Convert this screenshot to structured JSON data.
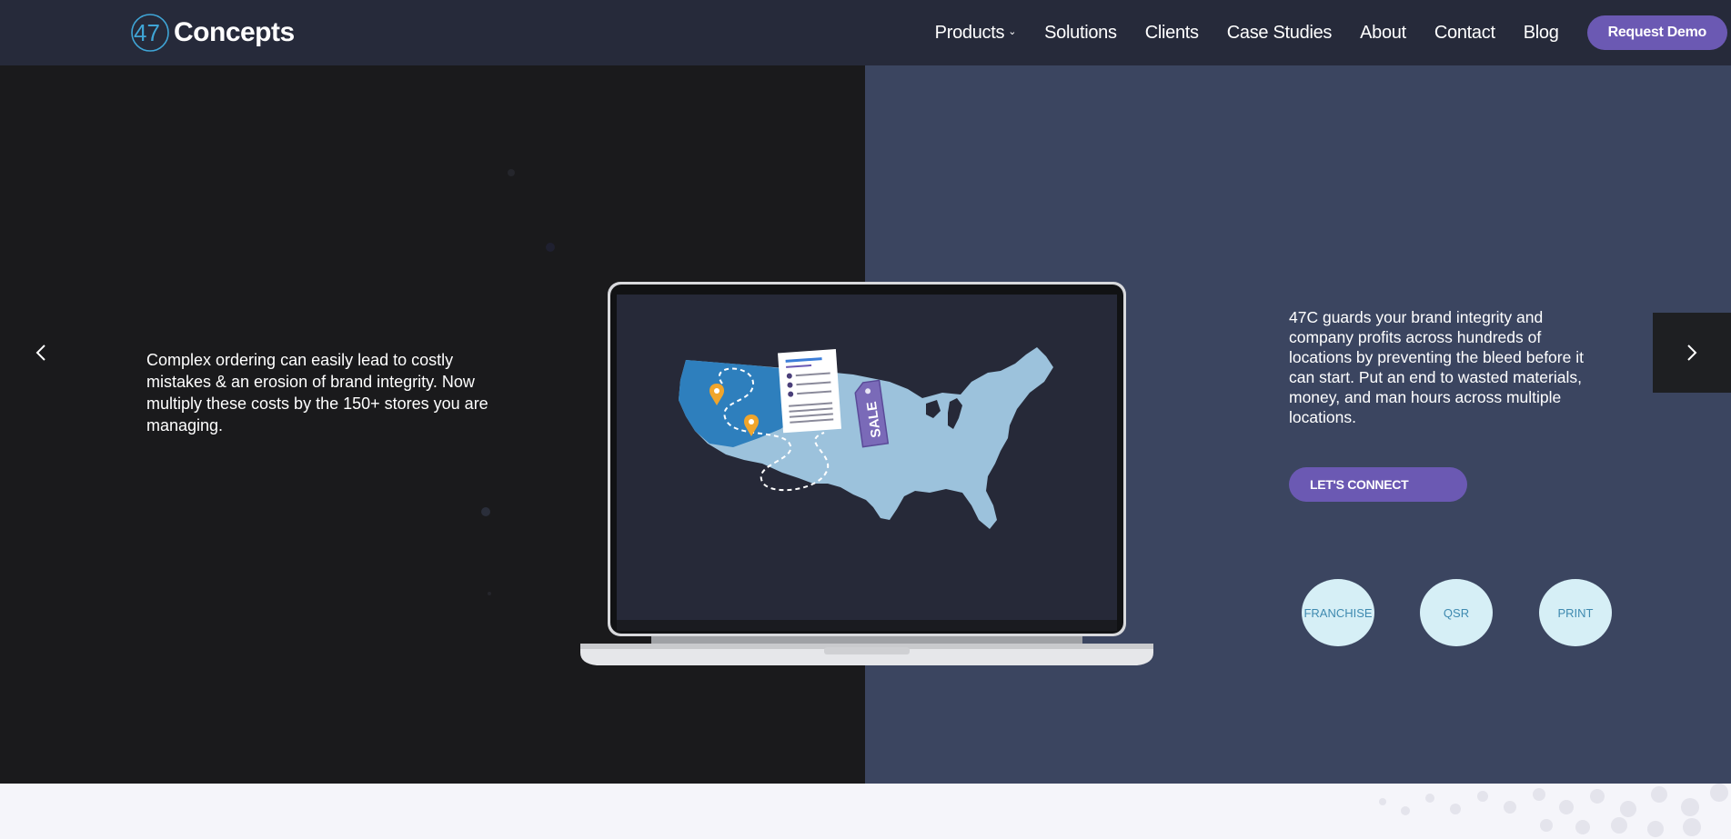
{
  "brand": {
    "logo_mark": "47",
    "name": "Concepts"
  },
  "nav": {
    "items": [
      {
        "label": "Products",
        "has_dropdown": true
      },
      {
        "label": "Solutions"
      },
      {
        "label": "Clients"
      },
      {
        "label": "Case Studies"
      },
      {
        "label": "About"
      },
      {
        "label": "Contact"
      },
      {
        "label": "Blog"
      }
    ],
    "cta": "Request Demo"
  },
  "hero": {
    "left_text": "Complex ordering can easily lead to costly mistakes & an erosion of brand integrity. Now multiply these costs by the 150+ stores you are managing.",
    "right_text": "47C guards your brand integrity and company profits across hundreds of locations by preventing the bleed before it can start. Put an end to wasted materials, money, and man hours across multiple locations.",
    "cta": "LET'S CONNECT",
    "circles": [
      "FRANCHISE",
      "QSR",
      "PRINT"
    ],
    "sale_tag": "SALE",
    "prev_icon": "chevron-left-icon",
    "next_icon": "chevron-right-icon"
  },
  "colors": {
    "header_bg": "#262a3a",
    "left_panel": "#1a1a1c",
    "right_panel": "#3b4560",
    "accent": "#6b59b3",
    "circle_bg": "#d6eff6",
    "circle_text": "#3f8ab0",
    "map_light": "#9cc2dc",
    "map_dark": "#2e7fbd"
  }
}
